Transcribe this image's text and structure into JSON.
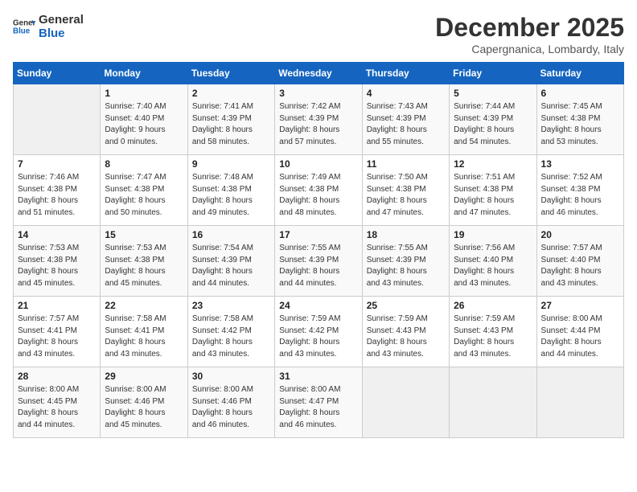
{
  "header": {
    "logo_line1": "General",
    "logo_line2": "Blue",
    "month": "December 2025",
    "location": "Capergnanica, Lombardy, Italy"
  },
  "days_of_week": [
    "Sunday",
    "Monday",
    "Tuesday",
    "Wednesday",
    "Thursday",
    "Friday",
    "Saturday"
  ],
  "weeks": [
    [
      {
        "day": "",
        "info": ""
      },
      {
        "day": "1",
        "info": "Sunrise: 7:40 AM\nSunset: 4:40 PM\nDaylight: 9 hours\nand 0 minutes."
      },
      {
        "day": "2",
        "info": "Sunrise: 7:41 AM\nSunset: 4:39 PM\nDaylight: 8 hours\nand 58 minutes."
      },
      {
        "day": "3",
        "info": "Sunrise: 7:42 AM\nSunset: 4:39 PM\nDaylight: 8 hours\nand 57 minutes."
      },
      {
        "day": "4",
        "info": "Sunrise: 7:43 AM\nSunset: 4:39 PM\nDaylight: 8 hours\nand 55 minutes."
      },
      {
        "day": "5",
        "info": "Sunrise: 7:44 AM\nSunset: 4:39 PM\nDaylight: 8 hours\nand 54 minutes."
      },
      {
        "day": "6",
        "info": "Sunrise: 7:45 AM\nSunset: 4:38 PM\nDaylight: 8 hours\nand 53 minutes."
      }
    ],
    [
      {
        "day": "7",
        "info": "Sunrise: 7:46 AM\nSunset: 4:38 PM\nDaylight: 8 hours\nand 51 minutes."
      },
      {
        "day": "8",
        "info": "Sunrise: 7:47 AM\nSunset: 4:38 PM\nDaylight: 8 hours\nand 50 minutes."
      },
      {
        "day": "9",
        "info": "Sunrise: 7:48 AM\nSunset: 4:38 PM\nDaylight: 8 hours\nand 49 minutes."
      },
      {
        "day": "10",
        "info": "Sunrise: 7:49 AM\nSunset: 4:38 PM\nDaylight: 8 hours\nand 48 minutes."
      },
      {
        "day": "11",
        "info": "Sunrise: 7:50 AM\nSunset: 4:38 PM\nDaylight: 8 hours\nand 47 minutes."
      },
      {
        "day": "12",
        "info": "Sunrise: 7:51 AM\nSunset: 4:38 PM\nDaylight: 8 hours\nand 47 minutes."
      },
      {
        "day": "13",
        "info": "Sunrise: 7:52 AM\nSunset: 4:38 PM\nDaylight: 8 hours\nand 46 minutes."
      }
    ],
    [
      {
        "day": "14",
        "info": "Sunrise: 7:53 AM\nSunset: 4:38 PM\nDaylight: 8 hours\nand 45 minutes."
      },
      {
        "day": "15",
        "info": "Sunrise: 7:53 AM\nSunset: 4:38 PM\nDaylight: 8 hours\nand 45 minutes."
      },
      {
        "day": "16",
        "info": "Sunrise: 7:54 AM\nSunset: 4:39 PM\nDaylight: 8 hours\nand 44 minutes."
      },
      {
        "day": "17",
        "info": "Sunrise: 7:55 AM\nSunset: 4:39 PM\nDaylight: 8 hours\nand 44 minutes."
      },
      {
        "day": "18",
        "info": "Sunrise: 7:55 AM\nSunset: 4:39 PM\nDaylight: 8 hours\nand 43 minutes."
      },
      {
        "day": "19",
        "info": "Sunrise: 7:56 AM\nSunset: 4:40 PM\nDaylight: 8 hours\nand 43 minutes."
      },
      {
        "day": "20",
        "info": "Sunrise: 7:57 AM\nSunset: 4:40 PM\nDaylight: 8 hours\nand 43 minutes."
      }
    ],
    [
      {
        "day": "21",
        "info": "Sunrise: 7:57 AM\nSunset: 4:41 PM\nDaylight: 8 hours\nand 43 minutes."
      },
      {
        "day": "22",
        "info": "Sunrise: 7:58 AM\nSunset: 4:41 PM\nDaylight: 8 hours\nand 43 minutes."
      },
      {
        "day": "23",
        "info": "Sunrise: 7:58 AM\nSunset: 4:42 PM\nDaylight: 8 hours\nand 43 minutes."
      },
      {
        "day": "24",
        "info": "Sunrise: 7:59 AM\nSunset: 4:42 PM\nDaylight: 8 hours\nand 43 minutes."
      },
      {
        "day": "25",
        "info": "Sunrise: 7:59 AM\nSunset: 4:43 PM\nDaylight: 8 hours\nand 43 minutes."
      },
      {
        "day": "26",
        "info": "Sunrise: 7:59 AM\nSunset: 4:43 PM\nDaylight: 8 hours\nand 43 minutes."
      },
      {
        "day": "27",
        "info": "Sunrise: 8:00 AM\nSunset: 4:44 PM\nDaylight: 8 hours\nand 44 minutes."
      }
    ],
    [
      {
        "day": "28",
        "info": "Sunrise: 8:00 AM\nSunset: 4:45 PM\nDaylight: 8 hours\nand 44 minutes."
      },
      {
        "day": "29",
        "info": "Sunrise: 8:00 AM\nSunset: 4:46 PM\nDaylight: 8 hours\nand 45 minutes."
      },
      {
        "day": "30",
        "info": "Sunrise: 8:00 AM\nSunset: 4:46 PM\nDaylight: 8 hours\nand 46 minutes."
      },
      {
        "day": "31",
        "info": "Sunrise: 8:00 AM\nSunset: 4:47 PM\nDaylight: 8 hours\nand 46 minutes."
      },
      {
        "day": "",
        "info": ""
      },
      {
        "day": "",
        "info": ""
      },
      {
        "day": "",
        "info": ""
      }
    ]
  ]
}
